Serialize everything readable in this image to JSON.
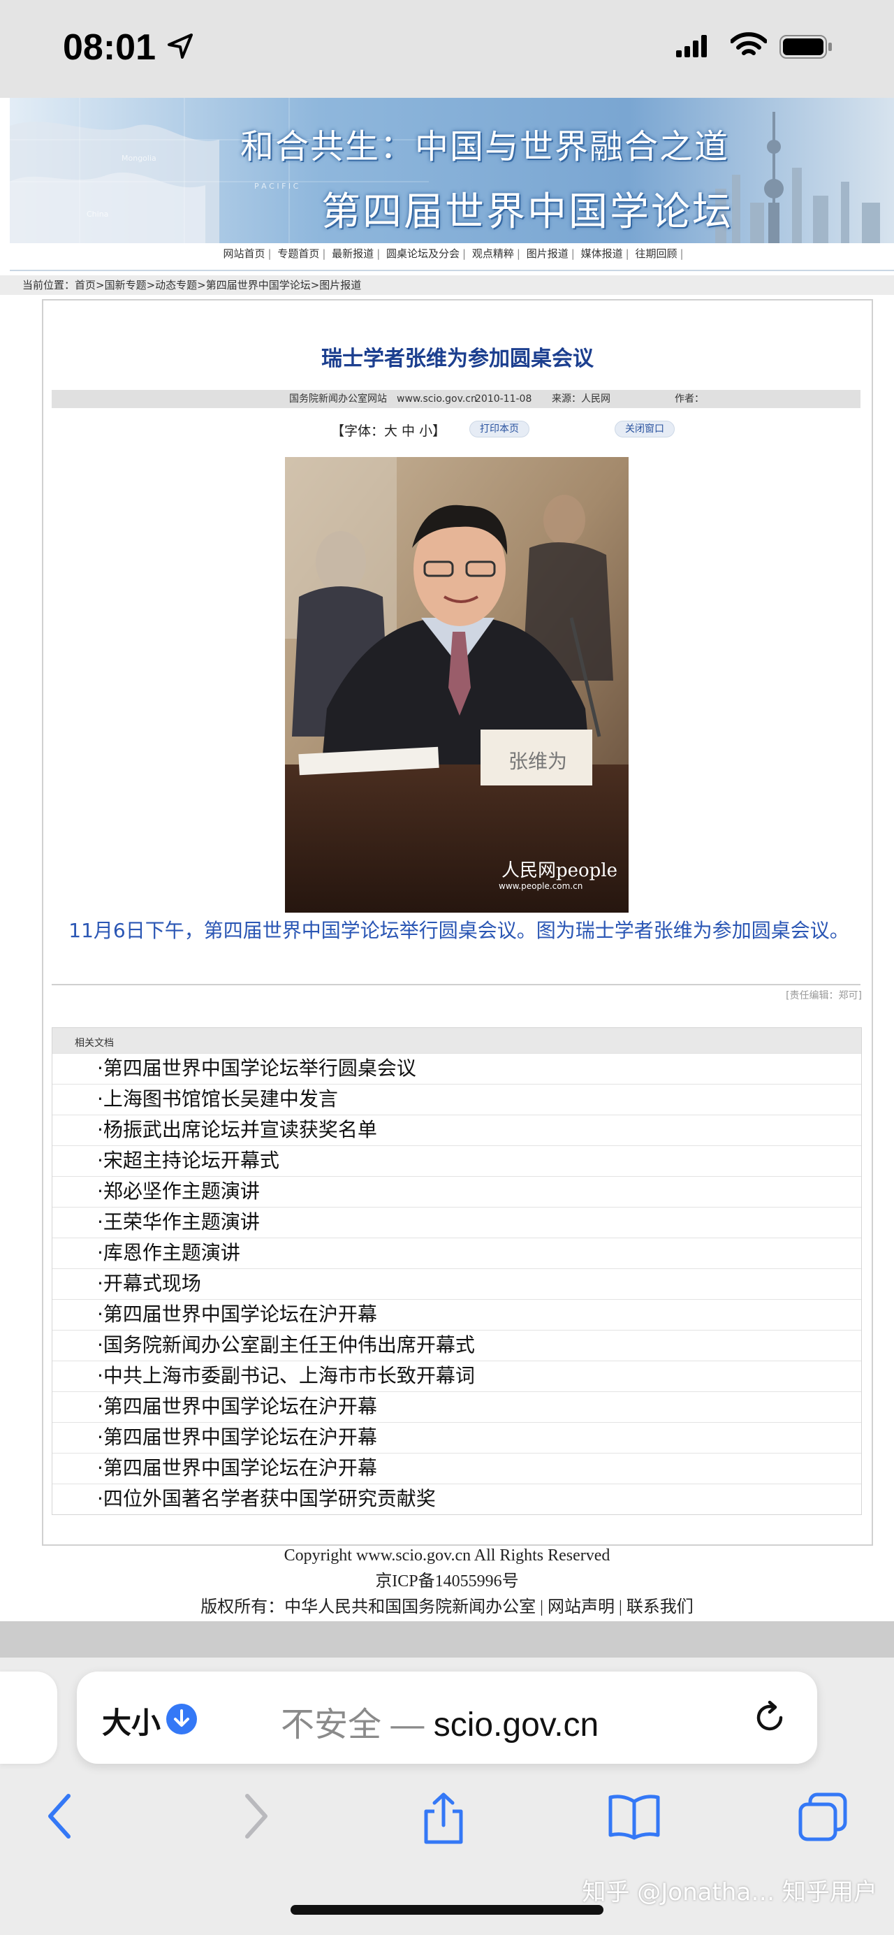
{
  "status_bar": {
    "time": "08:01"
  },
  "banner": {
    "title_line1": "和合共生：中国与世界融合之道",
    "title_line2": "第四届世界中国学论坛"
  },
  "nav_links": [
    "网站首页",
    "专题首页",
    "最新报道",
    "圆桌论坛及分会",
    "观点精粹",
    "图片报道",
    "媒体报道",
    "往期回顾"
  ],
  "breadcrumb": "当前位置：首页>国新专题>动态专题>第四届世界中国学论坛>图片报道",
  "article": {
    "title": "瑞士学者张维为参加圆桌会议",
    "source_site": "国务院新闻办公室网站　www.scio.gov.cn",
    "date": "2010-11-08",
    "source": "来源：人民网",
    "author": "作者：",
    "font_tool": "【字体：大 中 小】",
    "print_label": "打印本页",
    "close_label": "关闭窗口",
    "caption": "11月6日下午，第四届世界中国学论坛举行圆桌会议。图为瑞士学者张维为参加圆桌会议。",
    "editor": "[责任编辑：郑可]",
    "photo_watermark": "人民网people",
    "photo_watermark_url": "www.people.com.cn",
    "nameplate": "张维为"
  },
  "related": {
    "heading": "相关文档",
    "items": [
      "·第四届世界中国学论坛举行圆桌会议",
      "·上海图书馆馆长吴建中发言",
      "·杨振武出席论坛并宣读获奖名单",
      "·宋超主持论坛开幕式",
      "·郑必坚作主题演讲",
      "·王荣华作主题演讲",
      "·库恩作主题演讲",
      "·开幕式现场",
      "·第四届世界中国学论坛在沪开幕",
      "·国务院新闻办公室副主任王仲伟出席开幕式",
      "·中共上海市委副书记、上海市市长致开幕词",
      "·第四届世界中国学论坛在沪开幕",
      "·第四届世界中国学论坛在沪开幕",
      "·第四届世界中国学论坛在沪开幕",
      "·四位外国著名学者获中国学研究贡献奖"
    ]
  },
  "footer": {
    "copyright": "Copyright www.scio.gov.cn  All Rights Reserved",
    "icp": "京ICP备14055996号",
    "owner": "版权所有：中华人民共和国国务院新闻办公室 | 网站声明 | 联系我们"
  },
  "browser": {
    "text_size": "大小",
    "not_secure": "不安全 — ",
    "domain": "scio.gov.cn"
  },
  "watermark": "知乎 @Jonatha… 知乎用户",
  "colors": {
    "title_blue": "#1c3f8f",
    "caption_blue": "#2a56b4",
    "ios_blue": "#3478f6"
  }
}
